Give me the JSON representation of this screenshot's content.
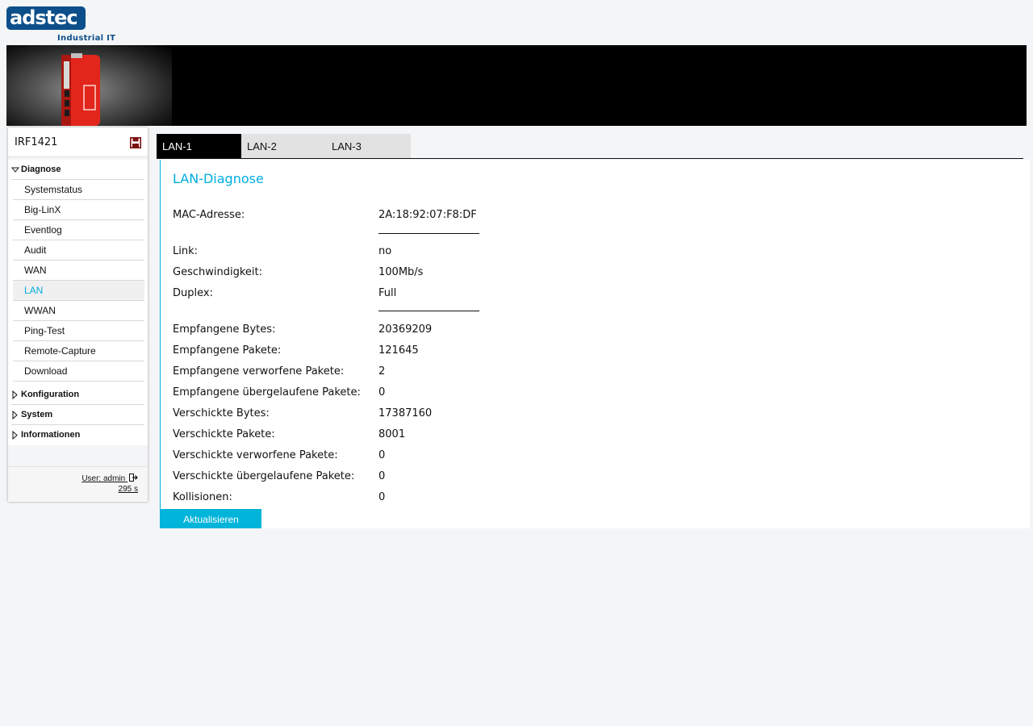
{
  "logo": {
    "mark": "adstec",
    "subtitle": "Industrial IT"
  },
  "device": {
    "name": "IRF1421",
    "save_icon": "save-disk-icon"
  },
  "sidebar": {
    "sections": [
      {
        "label": "Diagnose",
        "expanded": true
      },
      {
        "label": "Konfiguration",
        "expanded": false
      },
      {
        "label": "System",
        "expanded": false
      },
      {
        "label": "Informationen",
        "expanded": false
      }
    ],
    "items": [
      {
        "label": "Systemstatus"
      },
      {
        "label": "Big-LinX"
      },
      {
        "label": "Eventlog"
      },
      {
        "label": "Audit"
      },
      {
        "label": "WAN"
      },
      {
        "label": "LAN",
        "active": true
      },
      {
        "label": "WWAN"
      },
      {
        "label": "Ping-Test"
      },
      {
        "label": "Remote-Capture"
      },
      {
        "label": "Download"
      }
    ],
    "user_label": "User: admin",
    "session_timer": "295 s"
  },
  "tabs": [
    {
      "label": "LAN-1",
      "active": true
    },
    {
      "label": "LAN-2",
      "active": false
    },
    {
      "label": "LAN-3",
      "active": false
    }
  ],
  "panel": {
    "title": "LAN-Diagnose",
    "rows": [
      {
        "label": "MAC-Adresse:",
        "value": "2A:18:92:07:F8:DF"
      },
      {
        "label": "Link:",
        "value": "no"
      },
      {
        "label": "Geschwindigkeit:",
        "value": "100Mb/s"
      },
      {
        "label": "Duplex:",
        "value": "Full"
      },
      {
        "label": "Empfangene Bytes:",
        "value": "20369209"
      },
      {
        "label": "Empfangene Pakete:",
        "value": "121645"
      },
      {
        "label": "Empfangene verworfene Pakete:",
        "value": "2"
      },
      {
        "label": "Empfangene übergelaufene Pakete:",
        "value": "0"
      },
      {
        "label": "Verschickte Bytes:",
        "value": "17387160"
      },
      {
        "label": "Verschickte Pakete:",
        "value": "8001"
      },
      {
        "label": "Verschickte verworfene Pakete:",
        "value": "0"
      },
      {
        "label": "Verschickte übergelaufene Pakete:",
        "value": "0"
      },
      {
        "label": "Kollisionen:",
        "value": "0"
      }
    ],
    "refresh_label": "Aktualisieren"
  },
  "colors": {
    "accent": "#00aee0",
    "brand": "#0d4f8a",
    "device_red": "#e2261b"
  }
}
